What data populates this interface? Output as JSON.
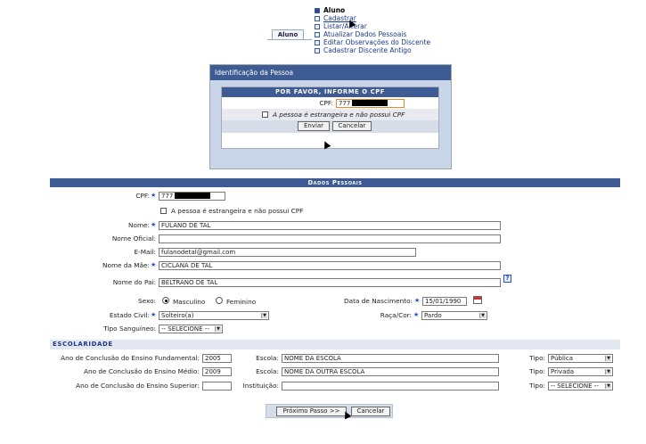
{
  "menu": {
    "tab_label": "Aluno",
    "header": "Aluno",
    "items": [
      {
        "label": "Cadastrar"
      },
      {
        "label": "Listar/Alterar"
      },
      {
        "label": "Atualizar Dados Pessoais"
      },
      {
        "label": "Editar Observações do Discente"
      },
      {
        "label": "Cadastrar Discente Antigo"
      }
    ]
  },
  "dialog": {
    "title": "Identificação da Pessoa",
    "subtitle": "Por favor, informe o CPF",
    "cpf_label": "CPF:",
    "cpf_value": "777",
    "foreign_label": "A pessoa é estrangeira e não possui CPF",
    "enviar_label": "Enviar",
    "cancelar_label": "Cancelar"
  },
  "form": {
    "section_title": "Dados Pessoais",
    "cpf_label": "CPF:",
    "cpf_value": "777",
    "foreign_label": "A pessoa é estrangeira e não possui CPF",
    "nome_label": "Nome:",
    "nome_value": "FULANO DE TAL",
    "nome_oficial_label": "Nome Oficial:",
    "nome_oficial_value": "",
    "email_label": "E-Mail:",
    "email_value": "fulanodetal@gmail.com",
    "mae_label": "Nome da Mãe:",
    "mae_value": "CICLANA DE TAL",
    "pai_label": "Nome do Pai:",
    "pai_value": "BELTRANO DE TAL",
    "help_symbol": "?",
    "sexo_label": "Sexo:",
    "masculino_label": "Masculino",
    "feminino_label": "Feminino",
    "nascimento_label": "Data de Nascimento:",
    "nascimento_value": "15/01/1990",
    "estado_civil_label": "Estado Civil:",
    "estado_civil_value": "Solteiro(a)",
    "raca_label": "Raça/Cor:",
    "raca_value": "Pardo",
    "sanguineo_label": "Tipo Sanguíneo:",
    "sanguineo_value": "-- SELECIONE --"
  },
  "escolaridade": {
    "title": "Escolaridade",
    "rows": [
      {
        "ano_label": "Ano de Conclusão do Ensino Fundamental:",
        "ano_value": "2005",
        "escola_label": "Escola:",
        "escola_value": "NOME DA ESCOLA",
        "tipo_label": "Tipo:",
        "tipo_value": "Pública"
      },
      {
        "ano_label": "Ano de Conclusão do Ensino Médio:",
        "ano_value": "2009",
        "escola_label": "Escola:",
        "escola_value": "NOME DA OUTRA ESCOLA",
        "tipo_label": "Tipo:",
        "tipo_value": "Privada"
      },
      {
        "ano_label": "Ano de Conclusão do Ensino Superior:",
        "ano_value": "",
        "escola_label": "Instituição:",
        "escola_value": "",
        "tipo_label": "Tipo:",
        "tipo_value": "-- SELECIONE --"
      }
    ]
  },
  "footer": {
    "proximo_label": "Próximo Passo >>",
    "cancelar_label": "Cancelar"
  },
  "icons": {
    "star": "★",
    "select_arrow": "▼"
  }
}
